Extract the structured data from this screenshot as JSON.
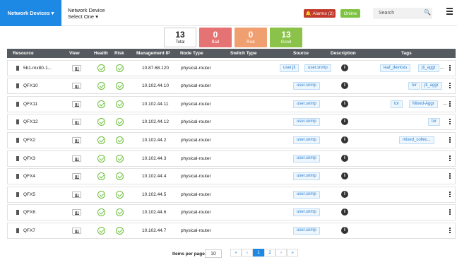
{
  "topbar": {
    "nav_button": "Network Devices",
    "device_label": "Network Device",
    "device_select": "Select One",
    "alarms": "Alarms (2)",
    "status": "Online",
    "search_placeholder": "Search"
  },
  "summary": {
    "total": {
      "value": "13",
      "label": "Total"
    },
    "bad": {
      "value": "0",
      "label": "Bad"
    },
    "risk": {
      "value": "0",
      "label": "Risk"
    },
    "good": {
      "value": "13",
      "label": "Good"
    }
  },
  "table": {
    "columns": [
      "Resource",
      "View",
      "Health",
      "Risk",
      "Management IP",
      "Node Type",
      "Switch Type",
      "Source",
      "Description",
      "Tags"
    ],
    "rows": [
      {
        "resource": "5b1-mx80-1...",
        "ip": "10.87.68.120",
        "node_type": "physical-router",
        "sources": [
          "user.jti",
          "user.snmp"
        ],
        "tags": [
          "leaf_devices",
          "jti_aggr"
        ],
        "more": "..."
      },
      {
        "resource": "QFX10",
        "ip": "10.102.44.10",
        "node_type": "physical-router",
        "sources": [
          "user.snmp"
        ],
        "tags": [
          "tor",
          "jti_aggr"
        ],
        "more": ""
      },
      {
        "resource": "QFX11",
        "ip": "10.102.44.11",
        "node_type": "physical-router",
        "sources": [
          "user.snmp"
        ],
        "tags": [
          "tor",
          "Mixed-Aggr"
        ],
        "more": "..."
      },
      {
        "resource": "QFX12",
        "ip": "10.102.44.12",
        "node_type": "physical-router",
        "sources": [
          "user.snmp"
        ],
        "tags": [
          "tor"
        ],
        "more": ""
      },
      {
        "resource": "QFX2",
        "ip": "10.102.44.2",
        "node_type": "physical-router",
        "sources": [
          "user.snmp"
        ],
        "tags": [
          "mixed_collec..."
        ],
        "more": ""
      },
      {
        "resource": "QFX3",
        "ip": "10.102.44.3",
        "node_type": "physical-router",
        "sources": [
          "user.snmp"
        ],
        "tags": [],
        "more": ""
      },
      {
        "resource": "QFX4",
        "ip": "10.102.44.4",
        "node_type": "physical-router",
        "sources": [
          "user.snmp"
        ],
        "tags": [],
        "more": ""
      },
      {
        "resource": "QFX5",
        "ip": "10.102.44.5",
        "node_type": "physical-router",
        "sources": [
          "user.snmp"
        ],
        "tags": [],
        "more": ""
      },
      {
        "resource": "QFX6",
        "ip": "10.102.44.6",
        "node_type": "physical-router",
        "sources": [
          "user.snmp"
        ],
        "tags": [],
        "more": ""
      },
      {
        "resource": "QFX7",
        "ip": "10.102.44.7",
        "node_type": "physical-router",
        "sources": [
          "user.snmp"
        ],
        "tags": [],
        "more": ""
      }
    ]
  },
  "pager": {
    "items_per_page_label": "Items per page:",
    "items_per_page": "10",
    "first": "«",
    "prev": "‹",
    "pages": [
      "1",
      "2"
    ],
    "next": "›",
    "last": "»"
  },
  "colors": {
    "accent": "#1e88e5",
    "bad": "#e57373",
    "risk": "#f0a070",
    "good": "#8bc34a",
    "alarm": "#c0392b",
    "header": "#555a60"
  },
  "icons": [
    "device-icon",
    "chart-icon",
    "check-icon",
    "info-icon",
    "kebab-icon",
    "bell-icon",
    "search-icon",
    "menu-icon"
  ]
}
